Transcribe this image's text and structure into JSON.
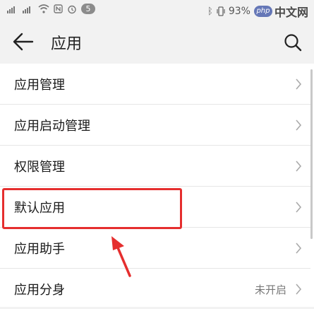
{
  "status_bar": {
    "notification_count": "5",
    "battery_percent": "93%",
    "icons": [
      "signal-icon",
      "signal-icon",
      "wifi-icon",
      "nfc-icon",
      "alarm-icon",
      "bluetooth-icon",
      "vibrate-icon",
      "battery-icon"
    ],
    "watermark": {
      "logo": "php",
      "text": "中文网"
    }
  },
  "header": {
    "title": "应用",
    "back_icon": "arrow-left-icon",
    "search_icon": "search-icon"
  },
  "menu": {
    "items": [
      {
        "label": "应用管理",
        "value": ""
      },
      {
        "label": "应用启动管理",
        "value": ""
      },
      {
        "label": "权限管理",
        "value": ""
      },
      {
        "label": "默认应用",
        "value": ""
      },
      {
        "label": "应用助手",
        "value": ""
      },
      {
        "label": "应用分身",
        "value": "未开启"
      }
    ]
  },
  "annotation": {
    "highlight_color": "#e52e2e",
    "highlighted_item": "默认应用"
  }
}
